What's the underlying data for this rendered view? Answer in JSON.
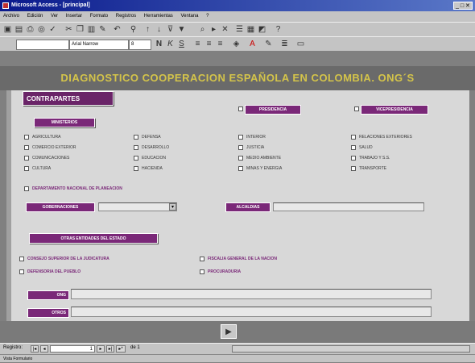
{
  "window": {
    "title": "Microsoft Access - [principal]",
    "buttons": "_ □ ✕"
  },
  "menu": [
    "Archivo",
    "Edición",
    "Ver",
    "Insertar",
    "Formato",
    "Registros",
    "Herramientas",
    "Ventana",
    "?"
  ],
  "toolbar": {
    "font_name": "Arial Narrow",
    "font_size": "8"
  },
  "form": {
    "heading": "DIAGNOSTICO COOPERACION ESPAÑOLA EN COLOMBIA. ONG´S",
    "tab_label": "CONTRAPARTES",
    "presidencia": "PRESIDENCIA",
    "vicepresidencia": "VICEPRESIDENCIA",
    "ministerios_label": "MINISTERIOS",
    "ministerios": [
      [
        "AGRICULTURA",
        "DEFENSA",
        "INTERIOR",
        "RELACIONES EXTERIORES"
      ],
      [
        "COMERCIO EXTERIOR",
        "DESARROLLO",
        "JUSTICIA",
        "SALUD"
      ],
      [
        "COMUNICACIONES",
        "EDUCACION",
        "MEDIO AMBIENTE",
        "TRABAJO Y S.S."
      ],
      [
        "CULTURA",
        "HACIENDA",
        "MINAS Y ENERGIA",
        "TRANSPORTE"
      ]
    ],
    "dnp": "DEPARTAMENTO NACIONAL DE PLANEACION",
    "gobernaciones_label": "GOBERNACIONES",
    "alcaldias_label": "ALCALDIAS",
    "otras_label": "OTRAS ENTIDADES DEL ESTADO",
    "otras": [
      "CONSEJO SUPERIOR DE LA JUDICATURA",
      "FISCALIA GENERAL DE LA NACION",
      "DEFENSORIA DEL PUEBLO",
      "PROCURADURIA"
    ],
    "ong_label": "ONG",
    "otros_label": "OTROS"
  },
  "nav": {
    "label": "Registro:",
    "current": "1",
    "total": "de 1"
  },
  "status": {
    "text": "Vista Formulario"
  }
}
